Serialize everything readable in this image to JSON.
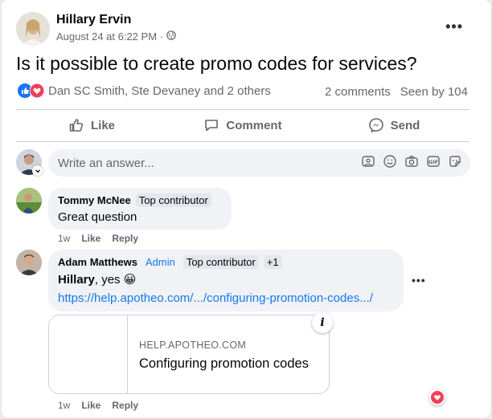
{
  "post": {
    "author": "Hillary Ervin",
    "date": "August 24 at 6:22 PM",
    "separator": "·",
    "title": "Is it possible to create promo codes for services?",
    "reaction_names": "Dan SC Smith, Ste Devaney and 2 others",
    "comments_count": "2 comments",
    "seen_by": "Seen by 104"
  },
  "actions": {
    "like": "Like",
    "comment": "Comment",
    "send": "Send"
  },
  "composer": {
    "placeholder": "Write an answer..."
  },
  "comments": [
    {
      "name": "Tommy McNee",
      "badge": "Top contributor",
      "text": "Great question",
      "time": "1w",
      "like": "Like",
      "reply": "Reply"
    },
    {
      "name": "Adam Matthews",
      "badge_admin": "Admin",
      "badge": "Top contributor",
      "extra_badges": "+1",
      "mention": "Hillary",
      "text": ", yes 😀",
      "link": "https://help.apotheo.com/.../configuring-promotion-codes.../",
      "preview": {
        "domain": "HELP.APOTHEO.COM",
        "title": "Configuring promotion codes"
      },
      "time": "1w",
      "like": "Like",
      "reply": "Reply"
    }
  ],
  "colors": {
    "accent": "#1877f2",
    "like_blue": "#1877f2",
    "love_red": "#f33e58",
    "muted": "#65676b"
  },
  "icons": [
    "globe-icon",
    "like-reaction-icon",
    "love-reaction-icon",
    "thumbs-up-icon",
    "comment-bubble-icon",
    "messenger-icon",
    "avatar-icon",
    "sticker-icon",
    "emoji-icon",
    "camera-icon",
    "gif-icon",
    "info-icon",
    "heart-reaction-icon"
  ]
}
